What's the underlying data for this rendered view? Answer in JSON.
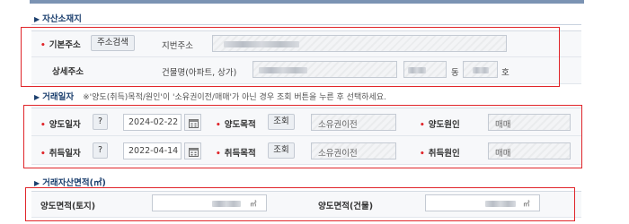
{
  "sections": {
    "location": {
      "title": "자산소재지"
    },
    "party": {
      "title": "거래일자",
      "note": "※'양도(취득)목적/원인'이 '소유권이전/매매'가 아닌 경우 조회 버튼을 누른 후 선택하세요."
    },
    "area": {
      "title": "거래자산면적(㎡)"
    }
  },
  "location": {
    "base_address_label": "기본주소",
    "address_search_button": "주소검색",
    "lot_address_label": "지번주소",
    "detail_address_label": "상세주소",
    "building_name_label": "건물명(아파트, 상가)",
    "dong_label": "동",
    "ho_label": "호"
  },
  "transfer": {
    "date_label": "양도일자",
    "help_button": "?",
    "date_value": "2024-02-22",
    "purpose_label": "양도목적",
    "lookup_button": "조회",
    "purpose_value": "소유권이전",
    "cause_label": "양도원인",
    "cause_value": "매매"
  },
  "acquisition": {
    "date_label": "취득일자",
    "help_button": "?",
    "date_value": "2022-04-14",
    "purpose_label": "취득목적",
    "lookup_button": "조회",
    "purpose_value": "소유권이전",
    "cause_label": "취득원인",
    "cause_value": "매매"
  },
  "area": {
    "land_label": "양도면적(토지)",
    "land_unit": "㎡",
    "building_label": "양도면적(건물)",
    "building_unit": "㎡"
  },
  "colors": {
    "highlight_border": "#e0252a",
    "section_title": "#1b3f6e"
  },
  "icons": {
    "calendar": "calendar-icon",
    "section_marker": "triangle-right-icon",
    "required_marker": "asterisk-icon"
  }
}
